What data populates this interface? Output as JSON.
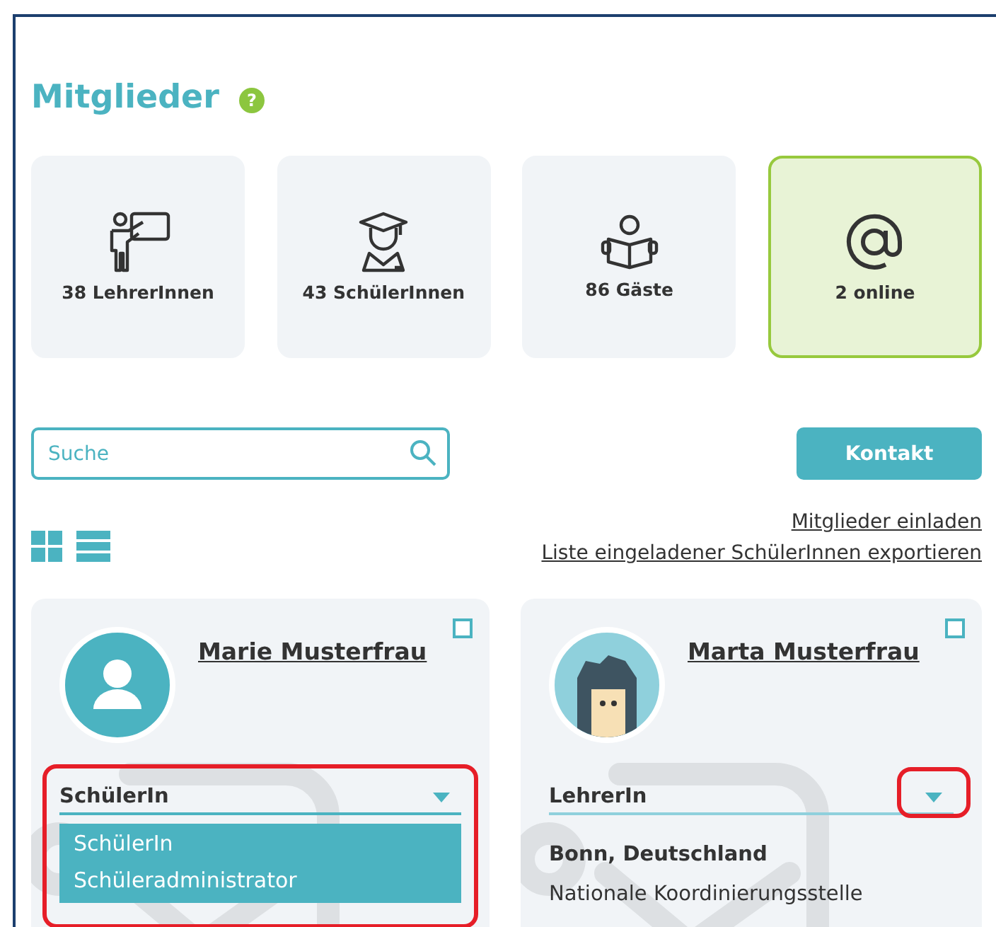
{
  "title": "Mitglieder",
  "help_icon": "?",
  "stats": [
    {
      "kind": "teacher",
      "label": "38 LehrerInnen",
      "selected": false
    },
    {
      "kind": "student",
      "label": "43 SchülerInnen",
      "selected": false
    },
    {
      "kind": "guest",
      "label": "86 Gäste",
      "selected": false
    },
    {
      "kind": "online",
      "label": "2 online",
      "selected": true
    }
  ],
  "search": {
    "placeholder": "Suche"
  },
  "contact_button": "Kontakt",
  "links": [
    "Mitglieder einladen",
    "Liste eingeladener SchülerInnen exportieren"
  ],
  "view_modes": [
    {
      "kind": "grid"
    },
    {
      "kind": "list"
    }
  ],
  "members": [
    {
      "name": "Marie Musterfrau",
      "avatar": {
        "kind": "silhouette"
      },
      "checked": false,
      "role": "SchülerIn",
      "expanded": true,
      "options": [
        "SchülerIn",
        "Schüleradministrator"
      ],
      "highlight": {
        "kind": "dropdown"
      }
    },
    {
      "name": "Marta Musterfrau",
      "avatar": {
        "kind": "cartoon"
      },
      "checked": false,
      "role": "LehrerIn",
      "expanded": false,
      "location": "Bonn, Deutschland",
      "organization": "Nationale Koordinierungsstelle",
      "highlight": {
        "kind": "caret"
      }
    }
  ]
}
